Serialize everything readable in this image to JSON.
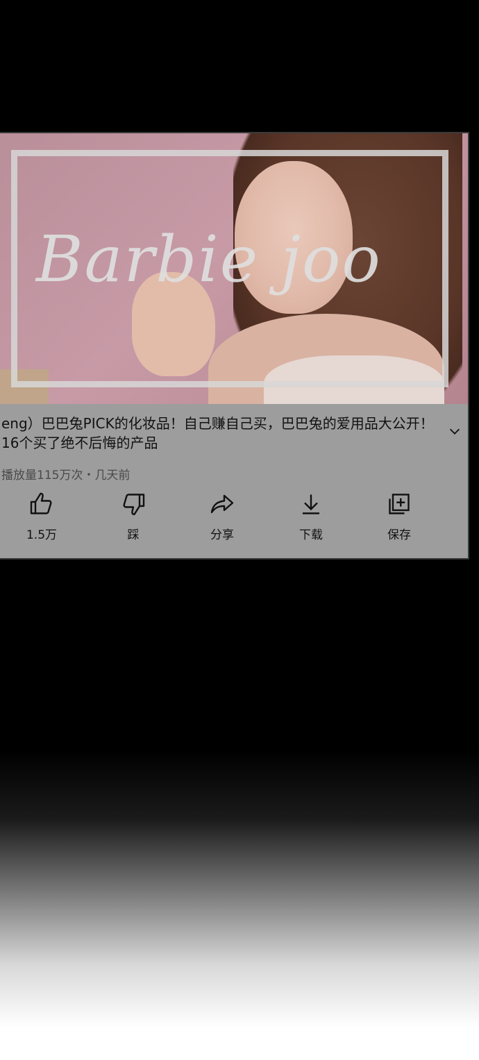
{
  "video": {
    "thumbnail_watermark": "Barbie joo",
    "title": "eng）巴巴兔PICK的化妆品！自己赚自己买，巴巴兔的爱用品大公开！16个买了绝不后悔的产品",
    "meta": "播放量115万次・几天前"
  },
  "actions": [
    {
      "label": "1.5万",
      "icon": "thumbs-up-icon"
    },
    {
      "label": "踩",
      "icon": "thumbs-down-icon"
    },
    {
      "label": "分享",
      "icon": "share-icon"
    },
    {
      "label": "下载",
      "icon": "download-icon"
    },
    {
      "label": "保存",
      "icon": "save-to-playlist-icon"
    }
  ]
}
